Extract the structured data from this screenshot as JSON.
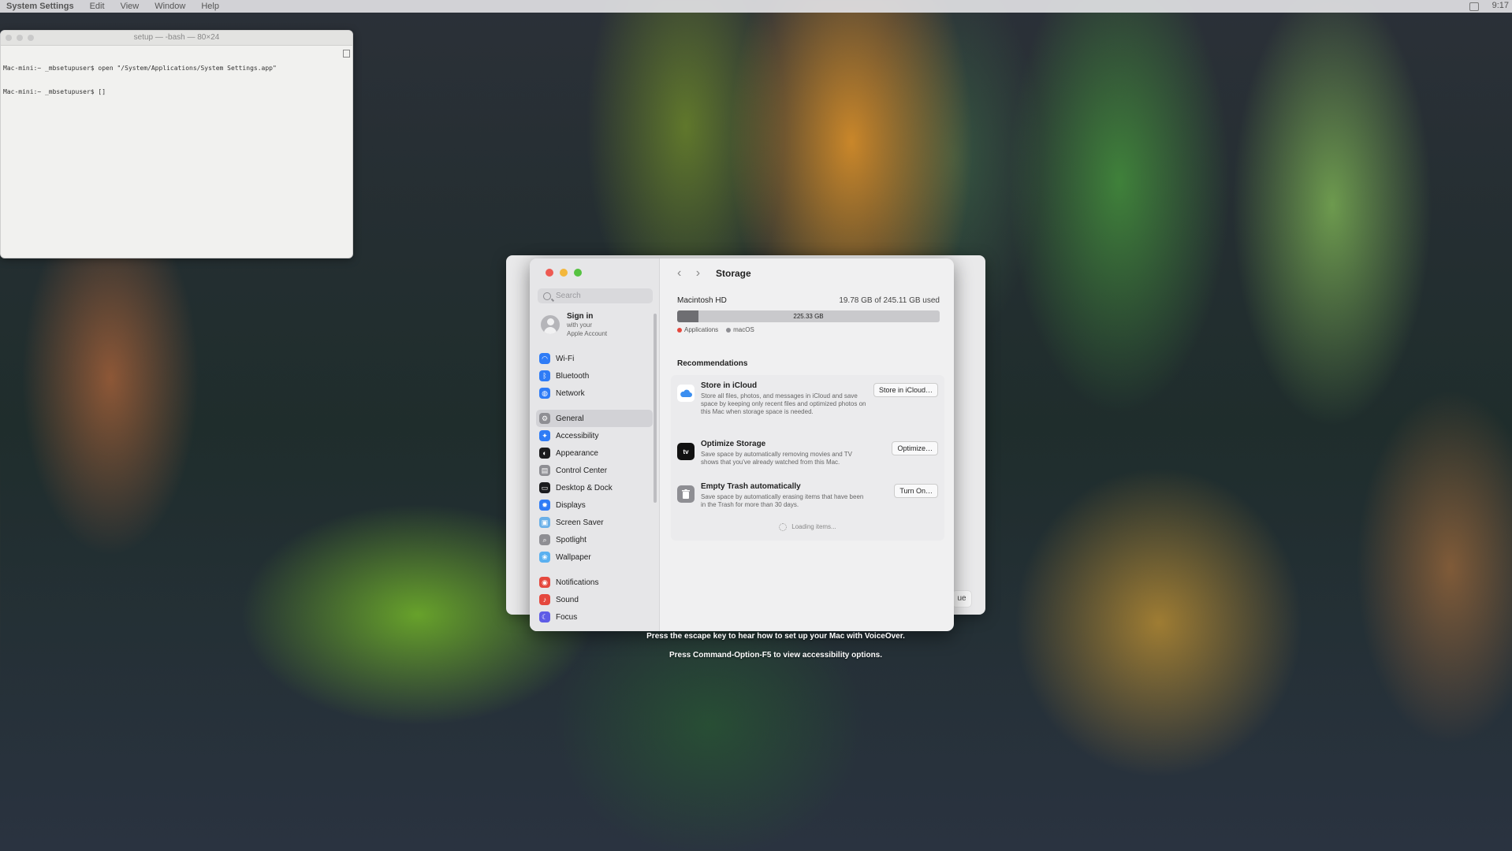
{
  "menubar": {
    "app": "System Settings",
    "items": [
      "Edit",
      "View",
      "Window",
      "Help"
    ],
    "clock": "9:17"
  },
  "terminal": {
    "title": "setup — -bash — 80×24",
    "lines": [
      "Mac-mini:~ _mbsetupuser$ open \"/System/Applications/System Settings.app\"",
      "Mac-mini:~ _mbsetupuser$ []"
    ]
  },
  "setup_panel": {
    "continue_fragment": "ue"
  },
  "settings": {
    "search_placeholder": "Search",
    "signin": {
      "title": "Sign in",
      "line2": "with your",
      "line3": "Apple Account"
    },
    "sidebar": [
      {
        "label": "Wi-Fi",
        "icon": "wifi-icon",
        "color": "#2f7cf6"
      },
      {
        "label": "Bluetooth",
        "icon": "bluetooth-icon",
        "color": "#2f7cf6"
      },
      {
        "label": "Network",
        "icon": "globe-icon",
        "color": "#2f7cf6"
      },
      {
        "label": "General",
        "icon": "gear-icon",
        "color": "#8e8e93",
        "active": true
      },
      {
        "label": "Accessibility",
        "icon": "accessibility-icon",
        "color": "#2f7cf6"
      },
      {
        "label": "Appearance",
        "icon": "appearance-icon",
        "color": "#1c1c1e"
      },
      {
        "label": "Control Center",
        "icon": "control-center-icon",
        "color": "#8e8e93"
      },
      {
        "label": "Desktop & Dock",
        "icon": "dock-icon",
        "color": "#1c1c1e"
      },
      {
        "label": "Displays",
        "icon": "displays-icon",
        "color": "#2f7cf6"
      },
      {
        "label": "Screen Saver",
        "icon": "screen-saver-icon",
        "color": "#6ab0e8"
      },
      {
        "label": "Spotlight",
        "icon": "spotlight-icon",
        "color": "#8e8e93"
      },
      {
        "label": "Wallpaper",
        "icon": "wallpaper-icon",
        "color": "#5ab0f0"
      },
      {
        "label": "Notifications",
        "icon": "notifications-icon",
        "color": "#e5483e"
      },
      {
        "label": "Sound",
        "icon": "sound-icon",
        "color": "#e5483e"
      },
      {
        "label": "Focus",
        "icon": "focus-icon",
        "color": "#5e5ce6"
      }
    ],
    "page_title": "Storage",
    "disk": {
      "name": "Macintosh HD",
      "used_text": "19.78 GB of 245.11 GB used",
      "bar_label": "225.33 GB",
      "used_fraction": 0.0807,
      "legend": [
        {
          "label": "Applications",
          "color": "#e5483e"
        },
        {
          "label": "macOS",
          "color": "#8e8e93"
        }
      ]
    },
    "recommendations_title": "Recommendations",
    "recommendations": [
      {
        "title": "Store in iCloud",
        "desc": "Store all files, photos, and messages in iCloud and save space by keeping only recent files and optimized photos on this Mac when storage space is needed.",
        "button": "Store in iCloud…",
        "icon": "icloud-icon"
      },
      {
        "title": "Optimize Storage",
        "desc": "Save space by automatically removing movies and TV shows that you've already watched from this Mac.",
        "button": "Optimize…",
        "icon": "apple-tv-icon"
      },
      {
        "title": "Empty Trash automatically",
        "desc": "Save space by automatically erasing items that have been in the Trash for more than 30 days.",
        "button": "Turn On…",
        "icon": "trash-icon"
      }
    ],
    "loading_text": "Loading items..."
  },
  "hints": {
    "line1": "Press the escape key to hear how to set up your Mac with VoiceOver.",
    "line2": "Press Command-Option-F5 to view accessibility options."
  }
}
